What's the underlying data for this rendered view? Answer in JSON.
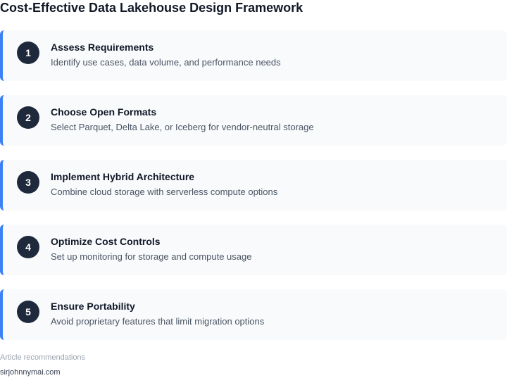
{
  "title": "Cost-Effective Data Lakehouse Design Framework",
  "steps": [
    {
      "number": "1",
      "title": "Assess Requirements",
      "description": "Identify use cases, data volume, and performance needs"
    },
    {
      "number": "2",
      "title": "Choose Open Formats",
      "description": "Select Parquet, Delta Lake, or Iceberg for vendor-neutral storage"
    },
    {
      "number": "3",
      "title": "Implement Hybrid Architecture",
      "description": "Combine cloud storage with serverless compute options"
    },
    {
      "number": "4",
      "title": "Optimize Cost Controls",
      "description": "Set up monitoring for storage and compute usage"
    },
    {
      "number": "5",
      "title": "Ensure Portability",
      "description": "Avoid proprietary features that limit migration options"
    }
  ],
  "footer": {
    "label": "Article recommendations",
    "source": "sirjohnnymai.com"
  },
  "colors": {
    "accent": "#3b82f6",
    "badge": "#1e293b",
    "card_background": "#f8fafc"
  }
}
